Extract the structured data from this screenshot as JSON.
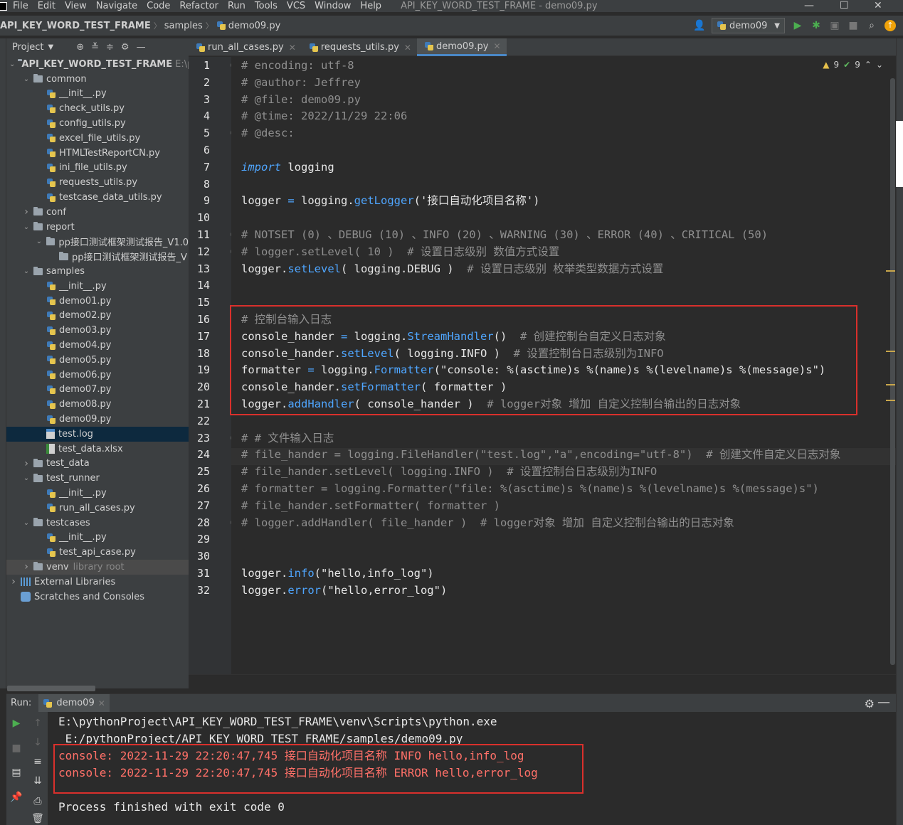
{
  "menu": {
    "items": [
      "File",
      "Edit",
      "View",
      "Navigate",
      "Code",
      "Refactor",
      "Run",
      "Tools",
      "VCS",
      "Window",
      "Help"
    ],
    "window_title": "API_KEY_WORD_TEST_FRAME - demo09.py"
  },
  "navbar": {
    "project": "API_KEY_WORD_TEST_FRAME",
    "folder": "samples",
    "file": "demo09.py",
    "run_config": "demo09"
  },
  "project_panel": {
    "title": "Project",
    "tree": [
      {
        "label": "API_KEY_WORD_TEST_FRAME",
        "extra": "E:\\p",
        "level": 0,
        "type": "folder",
        "open": true,
        "bold": true
      },
      {
        "label": "common",
        "level": 1,
        "type": "folder",
        "open": true
      },
      {
        "label": "__init__.py",
        "level": 2,
        "type": "py"
      },
      {
        "label": "check_utils.py",
        "level": 2,
        "type": "py"
      },
      {
        "label": "config_utils.py",
        "level": 2,
        "type": "py"
      },
      {
        "label": "excel_file_utils.py",
        "level": 2,
        "type": "py"
      },
      {
        "label": "HTMLTestReportCN.py",
        "level": 2,
        "type": "py"
      },
      {
        "label": "ini_file_utils.py",
        "level": 2,
        "type": "py"
      },
      {
        "label": "requests_utils.py",
        "level": 2,
        "type": "py"
      },
      {
        "label": "testcase_data_utils.py",
        "level": 2,
        "type": "py"
      },
      {
        "label": "conf",
        "level": 1,
        "type": "folder",
        "open": false
      },
      {
        "label": "report",
        "level": 1,
        "type": "folder",
        "open": true
      },
      {
        "label": "pp接口测试框架测试报告_V1.0",
        "level": 2,
        "type": "folder",
        "open": true
      },
      {
        "label": "pp接口测试框架测试报告_V",
        "level": 3,
        "type": "folder-leaf"
      },
      {
        "label": "samples",
        "level": 1,
        "type": "folder",
        "open": true
      },
      {
        "label": "__init__.py",
        "level": 2,
        "type": "py"
      },
      {
        "label": "demo01.py",
        "level": 2,
        "type": "py"
      },
      {
        "label": "demo02.py",
        "level": 2,
        "type": "py"
      },
      {
        "label": "demo03.py",
        "level": 2,
        "type": "py"
      },
      {
        "label": "demo04.py",
        "level": 2,
        "type": "py"
      },
      {
        "label": "demo05.py",
        "level": 2,
        "type": "py"
      },
      {
        "label": "demo06.py",
        "level": 2,
        "type": "py"
      },
      {
        "label": "demo07.py",
        "level": 2,
        "type": "py"
      },
      {
        "label": "demo08.py",
        "level": 2,
        "type": "py"
      },
      {
        "label": "demo09.py",
        "level": 2,
        "type": "py"
      },
      {
        "label": "test.log",
        "level": 2,
        "type": "log",
        "selected": true
      },
      {
        "label": "test_data.xlsx",
        "level": 2,
        "type": "xlsx"
      },
      {
        "label": "test_data",
        "level": 1,
        "type": "folder",
        "open": false
      },
      {
        "label": "test_runner",
        "level": 1,
        "type": "folder",
        "open": true
      },
      {
        "label": "__init__.py",
        "level": 2,
        "type": "py"
      },
      {
        "label": "run_all_cases.py",
        "level": 2,
        "type": "py"
      },
      {
        "label": "testcases",
        "level": 1,
        "type": "folder",
        "open": true
      },
      {
        "label": "__init__.py",
        "level": 2,
        "type": "py"
      },
      {
        "label": "test_api_case.py",
        "level": 2,
        "type": "py"
      },
      {
        "label": "venv",
        "extra": "library root",
        "level": 1,
        "type": "folder",
        "open": false,
        "venv": true
      },
      {
        "label": "External Libraries",
        "level": 0,
        "type": "lib",
        "open": false
      },
      {
        "label": "Scratches and Consoles",
        "level": 0,
        "type": "scratch"
      }
    ]
  },
  "tabs": [
    {
      "label": "run_all_cases.py",
      "active": false
    },
    {
      "label": "requests_utils.py",
      "active": false
    },
    {
      "label": "demo09.py",
      "active": true
    }
  ],
  "inspections": {
    "warnings": "9",
    "ok": "9"
  },
  "code": [
    [
      [
        "cmt",
        "# encoding: utf-8"
      ]
    ],
    [
      [
        "cmt",
        "# @author: Jeffrey"
      ]
    ],
    [
      [
        "cmt",
        "# @file: demo09.py"
      ]
    ],
    [
      [
        "cmt",
        "# @time: 2022/11/29 22:06"
      ]
    ],
    [
      [
        "cmt",
        "# @desc:"
      ]
    ],
    [],
    [
      [
        "kw",
        "import"
      ],
      [
        "op",
        " logging"
      ]
    ],
    [],
    [
      [
        "op",
        "logger "
      ],
      [
        "fn",
        "="
      ],
      [
        "op",
        " logging."
      ],
      [
        "fn",
        "getLogger"
      ],
      [
        "op",
        "('接口自动化项目名称')"
      ]
    ],
    [],
    [
      [
        "cmt",
        "# NOTSET (0) 、DEBUG (10) 、INFO (20) 、WARNING (30) 、ERROR (40) 、CRITICAL (50)"
      ]
    ],
    [
      [
        "cmt",
        "# logger.setLevel( 10 )  # 设置日志级别 数值方式设置"
      ]
    ],
    [
      [
        "op",
        "logger."
      ],
      [
        "fn",
        "setLevel"
      ],
      [
        "op",
        "( logging.DEBUG )  "
      ],
      [
        "cmt",
        "# 设置日志级别 枚举类型数据方式设置"
      ]
    ],
    [],
    [],
    [
      [
        "cmt",
        "# 控制台输入日志"
      ]
    ],
    [
      [
        "op",
        "console_hander "
      ],
      [
        "fn",
        "="
      ],
      [
        "op",
        " logging."
      ],
      [
        "fn",
        "StreamHandler"
      ],
      [
        "op",
        "()  "
      ],
      [
        "cmt",
        "# 创建控制台自定义日志对象"
      ]
    ],
    [
      [
        "op",
        "console_hander."
      ],
      [
        "fn",
        "setLevel"
      ],
      [
        "op",
        "( logging.INFO )  "
      ],
      [
        "cmt",
        "# 设置控制台日志级别为INFO"
      ]
    ],
    [
      [
        "op",
        "formatter "
      ],
      [
        "fn",
        "="
      ],
      [
        "op",
        " logging."
      ],
      [
        "fn",
        "Formatter"
      ],
      [
        "op",
        "(\"console: %(asctime)s %(name)s %(levelname)s %(message)s\")"
      ]
    ],
    [
      [
        "op",
        "console_hander."
      ],
      [
        "fn",
        "setFormatter"
      ],
      [
        "op",
        "( formatter )"
      ]
    ],
    [
      [
        "op",
        "logger."
      ],
      [
        "fn",
        "addHandler"
      ],
      [
        "op",
        "( console_hander )  "
      ],
      [
        "cmt",
        "# logger对象 增加 自定义控制台输出的日志对象"
      ]
    ],
    [],
    [
      [
        "cmt",
        "#"
      ],
      [
        "op",
        " "
      ],
      [
        "cmt",
        "# 文件输入日志"
      ]
    ],
    [
      [
        "cmt",
        "# file_hander = logging.FileHandler(\"test.log\",\"a\",encoding=\"utf-8\")  # 创建文件自定义日志对象"
      ]
    ],
    [
      [
        "cmt",
        "# file_hander.setLevel( logging.INFO )  # 设置控制台日志级别为INFO"
      ]
    ],
    [
      [
        "cmt",
        "# formatter = logging.Formatter(\"file: %(asctime)s %(name)s %(levelname)s %(message)s\")"
      ]
    ],
    [
      [
        "cmt",
        "# file_hander.setFormatter( formatter )"
      ]
    ],
    [
      [
        "cmt",
        "# logger.addHandler( file_hander )  # logger对象 增加 自定义控制台输出的日志对象"
      ]
    ],
    [],
    [],
    [
      [
        "op",
        "logger."
      ],
      [
        "fn",
        "info"
      ],
      [
        "op",
        "(\"hello,info_log\")"
      ]
    ],
    [
      [
        "op",
        "logger."
      ],
      [
        "fn",
        "error"
      ],
      [
        "op",
        "(\"hello,error_log\")"
      ]
    ]
  ],
  "run": {
    "label": "Run:",
    "tab": "demo09",
    "console": [
      {
        "text": "E:\\pythonProject\\API_KEY_WORD_TEST_FRAME\\venv\\Scripts\\python.exe",
        "kind": "normal"
      },
      {
        "text": " E:/pythonProject/API_KEY_WORD_TEST_FRAME/samples/demo09.py",
        "kind": "normal"
      },
      {
        "text": "console: 2022-11-29 22:20:47,745 接口自动化项目名称 INFO hello,info_log",
        "kind": "err"
      },
      {
        "text": "console: 2022-11-29 22:20:47,745 接口自动化项目名称 ERROR hello,error_log",
        "kind": "err"
      },
      {
        "text": "",
        "kind": "normal"
      },
      {
        "text": "Process finished with exit code 0",
        "kind": "normal"
      }
    ]
  },
  "colors": {
    "accent": "#4a88c7",
    "highlight_box": "#d9302c",
    "stderr": "#ff7068"
  }
}
